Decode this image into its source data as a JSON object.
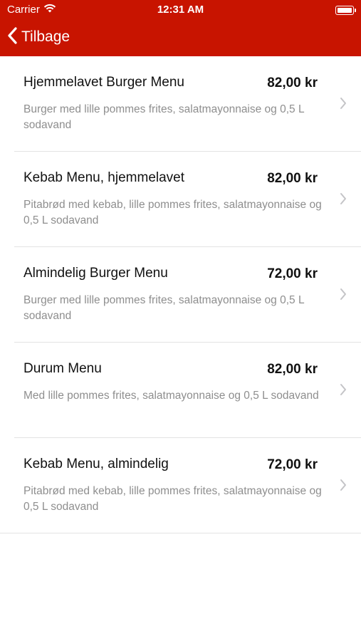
{
  "status_bar": {
    "carrier": "Carrier",
    "time": "12:31 AM"
  },
  "nav": {
    "back_label": "Tilbage",
    "color": "#c81400"
  },
  "menu_items": [
    {
      "title": "Hjemmelavet Burger Menu",
      "price": "82,00 kr",
      "description": "Burger med lille pommes frites, salatmayonnaise og 0,5 L sodavand"
    },
    {
      "title": "Kebab Menu, hjemmelavet",
      "price": "82,00 kr",
      "description": "Pitabrød med kebab, lille pommes frites, salatmayonnaise og 0,5 L sodavand"
    },
    {
      "title": "Almindelig Burger Menu",
      "price": "72,00 kr",
      "description": "Burger med lille pommes frites, salatmayonnaise og 0,5 L sodavand"
    },
    {
      "title": "Durum Menu",
      "price": "82,00 kr",
      "description": "Med lille pommes frites, salatmayonnaise og 0,5 L sodavand"
    },
    {
      "title": "Kebab Menu, almindelig",
      "price": "72,00 kr",
      "description": "Pitabrød med kebab, lille pommes frites, salatmayonnaise og 0,5 L sodavand"
    }
  ]
}
